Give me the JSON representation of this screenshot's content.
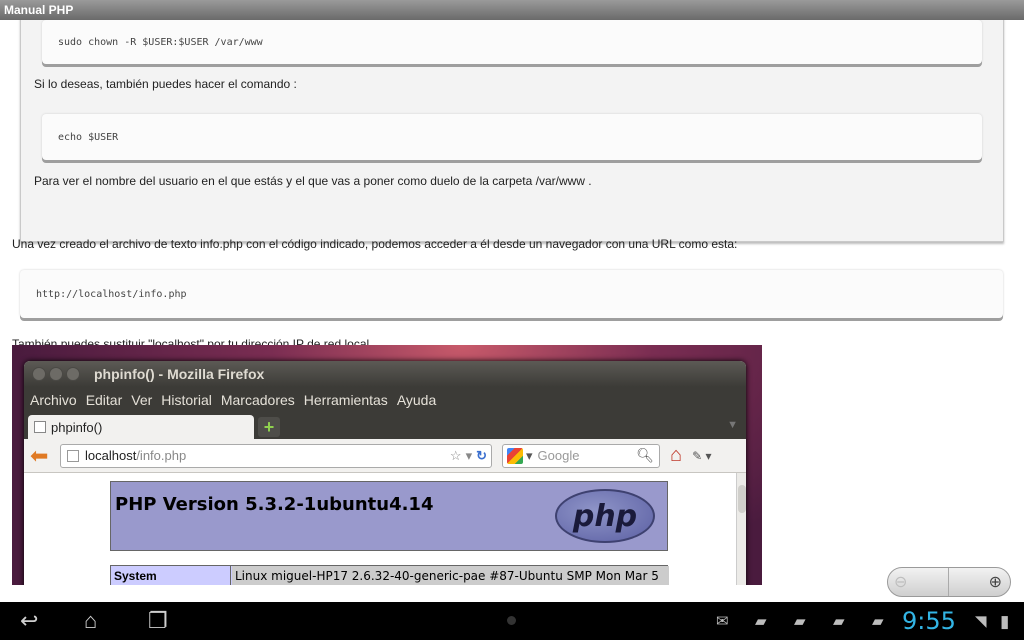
{
  "app": {
    "title": "Manual PHP"
  },
  "article": {
    "code1": "sudo chown -R $USER:$USER /var/www",
    "para1": "Si lo deseas, también puedes hacer el comando :",
    "code2": "echo $USER",
    "para2": "Para ver el nombre del usuario en el que estás y el que vas a poner como duelo de la carpeta /var/www .",
    "para3": "Una vez creado el archivo de texto info.php con el código indicado, podemos acceder a él desde un navegador con una URL como esta:",
    "code3": "http://localhost/info.php",
    "para4": "También puedes sustituir \"localhost\" por tu dirección IP de red local."
  },
  "screenshot": {
    "window_title": "phpinfo() - Mozilla Firefox",
    "menu": [
      "Archivo",
      "Editar",
      "Ver",
      "Historial",
      "Marcadores",
      "Herramientas",
      "Ayuda"
    ],
    "tab_label": "phpinfo()",
    "new_tab": "+",
    "url_host": "localhost",
    "url_path": "/info.php",
    "search_placeholder": "Google",
    "php_version": "PHP Version 5.3.2-1ubuntu4.14",
    "php_logo": "php",
    "system_label": "System",
    "system_value": "Linux miguel-HP17 2.6.32-40-generic-pae #87-Ubuntu SMP Mon Mar 5"
  },
  "zoom": {
    "out_icon": "zoom-out-icon",
    "in_icon": "zoom-in-icon"
  },
  "statusbar": {
    "time": "9:55"
  },
  "colors": {
    "clock": "#33b5e5",
    "titlebar": "#7a7a7a",
    "php_banner": "#9999cc"
  }
}
